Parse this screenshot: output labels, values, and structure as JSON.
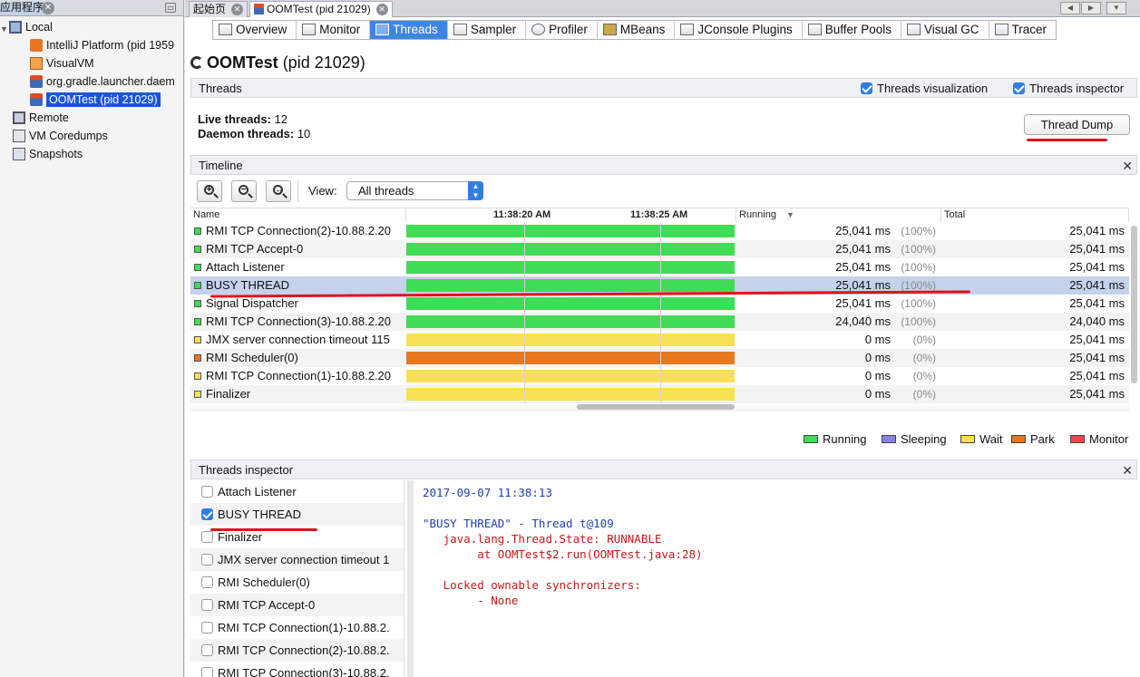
{
  "explorer": {
    "title": "应用程序",
    "local_label": "Local",
    "apps": [
      {
        "label": "IntelliJ Platform (pid 1959",
        "icon": "intellij-icon"
      },
      {
        "label": "VisualVM",
        "icon": "visualvm-icon"
      },
      {
        "label": "org.gradle.launcher.daem",
        "icon": "java-icon"
      },
      {
        "label": "OOMTest (pid 21029)",
        "icon": "java-icon",
        "selected": true
      }
    ],
    "remote_label": "Remote",
    "coredumps_label": "VM Coredumps",
    "snapshots_label": "Snapshots"
  },
  "doc_tabs": [
    {
      "label": "起始页"
    },
    {
      "label": "OOMTest (pid 21029)",
      "active": true
    }
  ],
  "sub_tabs": [
    "Overview",
    "Monitor",
    "Threads",
    "Sampler",
    "Profiler",
    "MBeans",
    "JConsole Plugins",
    "Buffer Pools",
    "Visual GC",
    "Tracer"
  ],
  "active_sub_tab": "Threads",
  "page": {
    "app_name": "OOMTest",
    "pid_text": "(pid 21029)"
  },
  "threads": {
    "section_title": "Threads",
    "visualization_label": "Threads visualization",
    "inspector_label": "Threads inspector",
    "live_label": "Live threads:",
    "live_value": "12",
    "daemon_label": "Daemon threads:",
    "daemon_value": "10",
    "dump_button": "Thread Dump"
  },
  "timeline": {
    "section_title": "Timeline",
    "view_label": "View:",
    "view_value": "All threads",
    "col_name": "Name",
    "time1": "11:38:20 AM",
    "time2": "11:38:25 AM",
    "col_running": "Running",
    "col_total": "Total",
    "rows": [
      {
        "name": "RMI TCP Connection(2)-10.88.2.20",
        "state": "running",
        "running": "25,041 ms",
        "pct": "(100%)",
        "total": "25,041 ms"
      },
      {
        "name": "RMI TCP Accept-0",
        "state": "running",
        "running": "25,041 ms",
        "pct": "(100%)",
        "total": "25,041 ms"
      },
      {
        "name": "Attach Listener",
        "state": "running",
        "running": "25,041 ms",
        "pct": "(100%)",
        "total": "25,041 ms"
      },
      {
        "name": "BUSY THREAD",
        "state": "running",
        "running": "25,041 ms",
        "pct": "(100%)",
        "total": "25,041 ms",
        "selected": true
      },
      {
        "name": "Signal Dispatcher",
        "state": "running",
        "running": "25,041 ms",
        "pct": "(100%)",
        "total": "25,041 ms"
      },
      {
        "name": "RMI TCP Connection(3)-10.88.2.20",
        "state": "running",
        "running": "24,040 ms",
        "pct": "(100%)",
        "total": "24,040 ms"
      },
      {
        "name": "JMX server connection timeout 115",
        "state": "wait",
        "running": "0 ms",
        "pct": "(0%)",
        "total": "25,041 ms"
      },
      {
        "name": "RMI Scheduler(0)",
        "state": "park",
        "running": "0 ms",
        "pct": "(0%)",
        "total": "25,041 ms"
      },
      {
        "name": "RMI TCP Connection(1)-10.88.2.20",
        "state": "wait",
        "running": "0 ms",
        "pct": "(0%)",
        "total": "25,041 ms"
      },
      {
        "name": "Finalizer",
        "state": "wait",
        "running": "0 ms",
        "pct": "(0%)",
        "total": "25,041 ms"
      }
    ],
    "legend": [
      {
        "label": "Running",
        "color": "#3fdc55"
      },
      {
        "label": "Sleeping",
        "color": "#8a80e8"
      },
      {
        "label": "Wait",
        "color": "#f8e054"
      },
      {
        "label": "Park",
        "color": "#e8781e"
      },
      {
        "label": "Monitor",
        "color": "#f04848"
      }
    ]
  },
  "inspector": {
    "section_title": "Threads inspector",
    "threads": [
      {
        "label": "Attach Listener",
        "checked": false
      },
      {
        "label": "BUSY THREAD",
        "checked": true
      },
      {
        "label": "Finalizer",
        "checked": false
      },
      {
        "label": "JMX server connection timeout 1",
        "checked": false
      },
      {
        "label": "RMI Scheduler(0)",
        "checked": false
      },
      {
        "label": "RMI TCP Accept-0",
        "checked": false
      },
      {
        "label": "RMI TCP Connection(1)-10.88.2.",
        "checked": false
      },
      {
        "label": "RMI TCP Connection(2)-10.88.2.",
        "checked": false
      },
      {
        "label": "RMI TCP Connection(3)-10.88.2.",
        "checked": false
      }
    ],
    "dump_timestamp": "2017-09-07 11:38:13",
    "dump_header": "\"BUSY THREAD\" - Thread t@109",
    "dump_state": "java.lang.Thread.State: RUNNABLE",
    "dump_frame": "at OOMTest$2.run(OOMTest.java:28)",
    "dump_locked_label": "Locked ownable synchronizers:",
    "dump_locked_value": "- None"
  },
  "colors": {
    "running": "#3fdc55",
    "wait": "#f8e054",
    "park": "#e8781e",
    "selection": "#1a56d6",
    "annotation": "#e0121b"
  }
}
